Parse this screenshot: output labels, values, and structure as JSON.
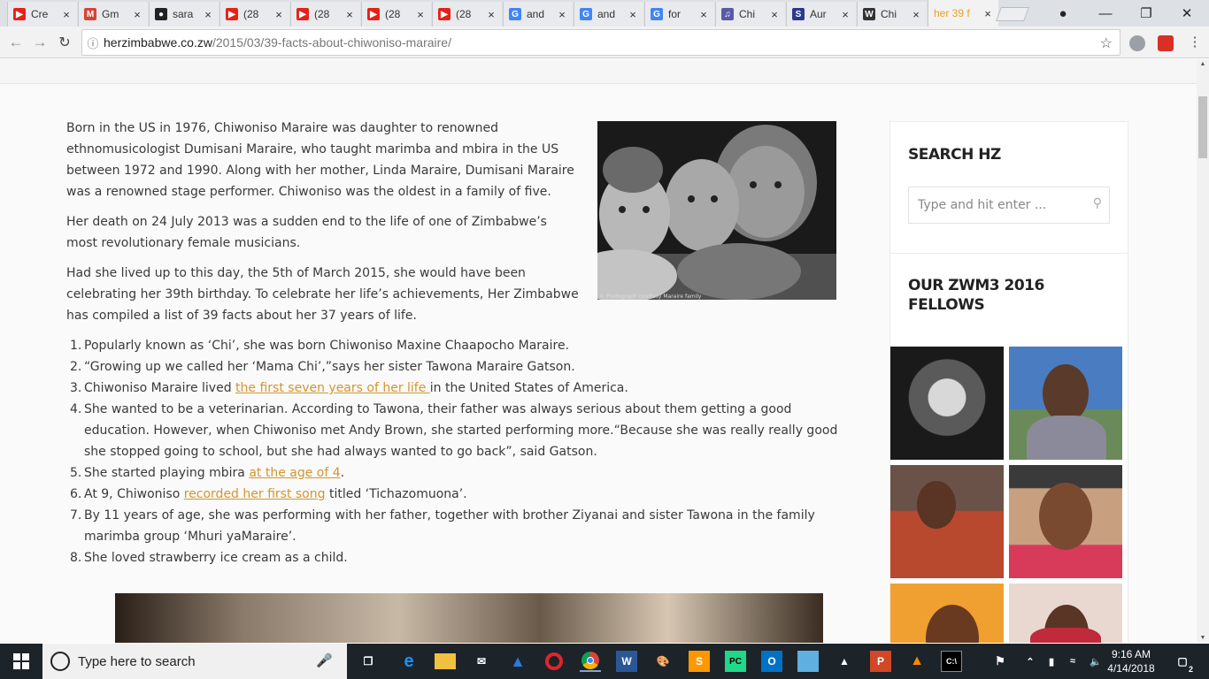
{
  "browser": {
    "tabs": [
      {
        "title": "Cre",
        "icon": "youtube-icon",
        "color": "#e62117"
      },
      {
        "title": "Gm",
        "icon": "gmail-icon",
        "color": "#d44638"
      },
      {
        "title": "sara",
        "icon": "github-icon",
        "color": "#222222"
      },
      {
        "title": "(28",
        "icon": "youtube-icon",
        "color": "#e62117"
      },
      {
        "title": "(28",
        "icon": "youtube-icon",
        "color": "#e62117"
      },
      {
        "title": "(28",
        "icon": "youtube-icon",
        "color": "#e62117"
      },
      {
        "title": "(28",
        "icon": "youtube-icon",
        "color": "#e62117"
      },
      {
        "title": "and",
        "icon": "google-icon",
        "color": "#4285f4"
      },
      {
        "title": "and",
        "icon": "google-icon",
        "color": "#4285f4"
      },
      {
        "title": "for",
        "icon": "google-icon",
        "color": "#4285f4"
      },
      {
        "title": "Chi",
        "icon": "music-icon",
        "color": "#5a5aa8"
      },
      {
        "title": "Aur",
        "icon": "s-logo-icon",
        "color": "#2d3a8c"
      },
      {
        "title": "Chi",
        "icon": "wikipedia-icon",
        "color": "#333333"
      },
      {
        "title": "her 39 f",
        "icon": "none",
        "color": "#e8a020",
        "active": true
      }
    ],
    "url_host": "herzimbabwe.co.zw",
    "url_path": "/2015/03/39-facts-about-chiwoniso-maraire/"
  },
  "article": {
    "paragraphs": [
      "Born in the US in 1976, Chiwoniso Maraire was daughter to renowned ethnomusicologist Dumisani Maraire, who taught marimba and mbira in the US between 1972 and 1990. Along with her mother, Linda Maraire, Dumisani Maraire was a renowned stage performer. Chiwoniso was the oldest in a family of five.",
      "Her death on 24 July 2013 was a sudden end to the life of one of Zimbabwe’s most revolutionary female musicians.",
      "Had she lived up to this day, the 5th of March 2015, she would have been celebrating her 39th birthday. To celebrate her life’s achievements, Her Zimbabwe has compiled a list of 39 facts about her 37 years of life."
    ],
    "facts": [
      {
        "n": "1.",
        "before": "Popularly known as ‘Chi’, she was born Chiwoniso Maxine Chaapocho Maraire.",
        "link": "",
        "after": ""
      },
      {
        "n": "2.",
        "before": "“Growing up we called her ‘Mama Chi’,”says her sister Tawona Maraire Gatson.",
        "link": "",
        "after": ""
      },
      {
        "n": "3.",
        "before": "Chiwoniso Maraire lived ",
        "link": "the first seven years of her life ",
        "after": "in the United States of America."
      },
      {
        "n": "4.",
        "before": "She wanted to be a veterinarian. According to Tawona, their father was always serious about them getting a good education. However, when Chiwoniso met Andy Brown, she started performing more.“Because she was really really good she stopped going to school, but she had always wanted to go back”, said Gatson.",
        "link": "",
        "after": ""
      },
      {
        "n": "5.",
        "before": "She started playing mbira ",
        "link": "at the age of 4",
        "after": "."
      },
      {
        "n": "6.",
        "before": "At 9, Chiwoniso ",
        "link": "recorded her first song",
        "after": " titled ‘Tichazomuona’."
      },
      {
        "n": "7.",
        "before": "By 11 years of age, she was performing with her father, together with brother Ziyanai and sister Tawona in the family marimba group ‘Mhuri yaMaraire’.",
        "link": "",
        "after": ""
      },
      {
        "n": "8.",
        "before": "She loved strawberry ice cream as a child.",
        "link": "",
        "after": ""
      }
    ],
    "image_caption": "© Photograph courtesy Maraire family",
    "link_color": "#d4952e"
  },
  "sidebar": {
    "search_title": "SEARCH HZ",
    "search_placeholder": "Type and hit enter ...",
    "fellows_title_1": "OUR ZWM3 2016",
    "fellows_title_2": "FELLOWS"
  },
  "taskbar": {
    "search_placeholder": "Type here to search",
    "time": "9:16 AM",
    "date": "4/14/2018",
    "notifications": "2"
  }
}
